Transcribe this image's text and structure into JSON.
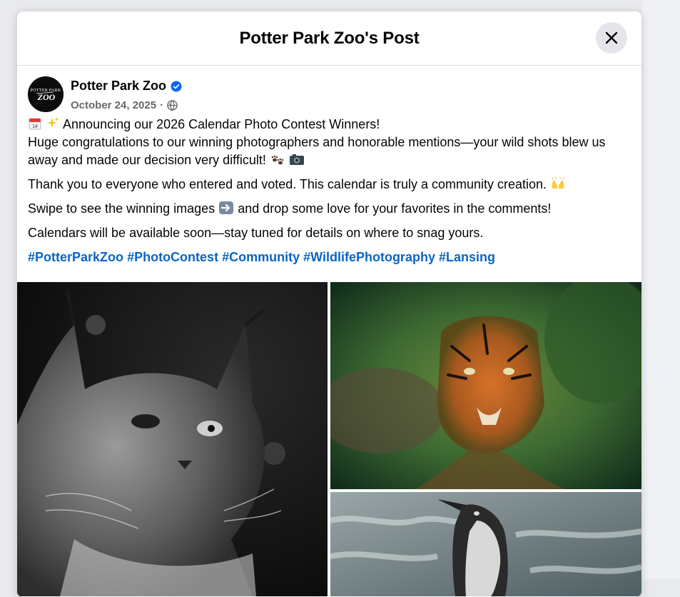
{
  "dialog": {
    "title": "Potter Park Zoo's Post"
  },
  "post": {
    "author": "Potter Park Zoo",
    "avatar_text_top": "POTTER PARK",
    "avatar_text_main": "ZOO",
    "date": "October 24, 2025",
    "separator": "·",
    "privacy_icon": "globe-icon",
    "paragraphs": {
      "p1_line1": "Announcing our 2026 Calendar Photo Contest Winners!",
      "p1_line2": "Huge congratulations to our winning photographers and honorable mentions—your wild shots blew us away and made our decision very difficult!",
      "p2": "Thank you to everyone who entered and voted. This calendar is truly a community creation.",
      "p3_a": "Swipe to see the winning images",
      "p3_b": "and drop some love for your favorites in the comments!",
      "p4": "Calendars will be available soon—stay tuned for details on where to snag yours."
    },
    "hashtags": [
      "#PotterParkZoo",
      "#PhotoContest",
      "#Community",
      "#WildlifePhotography",
      "#Lansing"
    ],
    "photos": [
      "lynx-photo",
      "tiger-photo",
      "penguin-photo"
    ]
  },
  "colors": {
    "link": "#0a65c7",
    "verified": "#0866ff",
    "secondary_text": "#65676b"
  }
}
